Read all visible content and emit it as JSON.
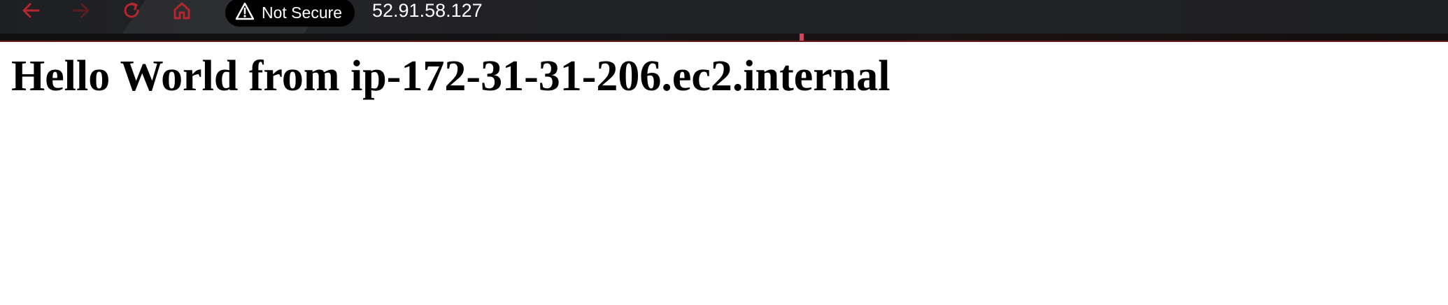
{
  "browser": {
    "nav": {
      "back_icon": "arrow-left-icon",
      "forward_icon": "arrow-right-icon",
      "reload_icon": "reload-icon",
      "home_icon": "home-icon",
      "icon_color": "#b3262d",
      "forward_icon_color": "#5a1e22"
    },
    "security": {
      "icon": "warning-triangle-icon",
      "label": "Not Secure"
    },
    "address": {
      "url": "52.91.58.127"
    },
    "colors": {
      "toolbar_bg": "#1e1f22",
      "chip_bg": "#000000",
      "accent": "#d0455b"
    }
  },
  "page": {
    "heading": "Hello World from ip-172-31-31-206.ec2.internal",
    "background": "#ffffff"
  }
}
